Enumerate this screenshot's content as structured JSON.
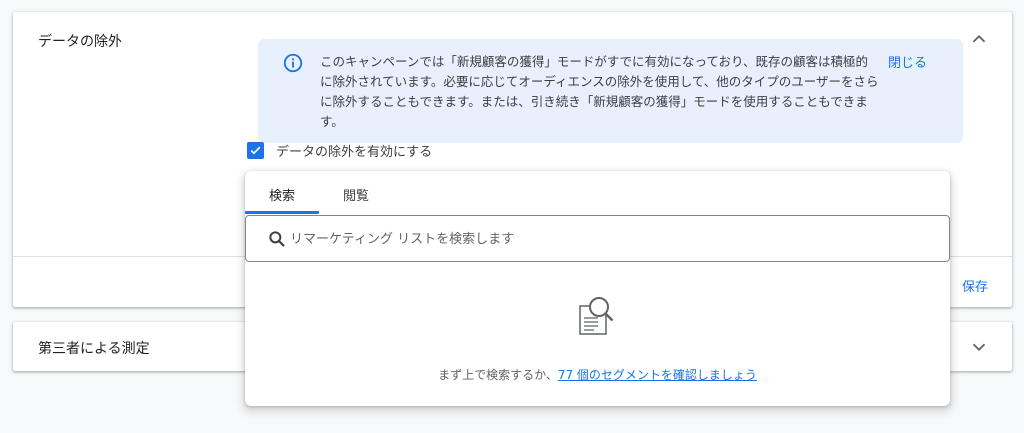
{
  "sections": {
    "data_exclusion": {
      "title": "データの除外"
    },
    "third_party": {
      "title": "第三者による測定"
    }
  },
  "info_banner": {
    "text": "このキャンペーンでは「新規顧客の獲得」モードがすでに有効になっており、既存の顧客は積極的に除外されています。必要に応じてオーディエンスの除外を使用して、他のタイプのユーザーをさらに除外することもできます。または、引き続き「新規顧客の獲得」モードを使用することもできます。",
    "close_label": "閉じる"
  },
  "checkbox": {
    "label": "データの除外を有効にする",
    "checked": true
  },
  "tabs": [
    {
      "label": "検索"
    },
    {
      "label": "閲覧"
    }
  ],
  "search": {
    "placeholder": "リマーケティング リストを検索します"
  },
  "empty_state": {
    "prefix": "まず上で検索するか、",
    "link": "77 個のセグメントを確認しましょう"
  },
  "save_label": "保存",
  "colors": {
    "accent": "#1a73e8",
    "banner_bg": "#e8f0fe"
  },
  "icons": [
    "info-icon",
    "chevron-up-icon",
    "chevron-down-icon",
    "check-icon",
    "search-icon",
    "document-search-icon"
  ]
}
